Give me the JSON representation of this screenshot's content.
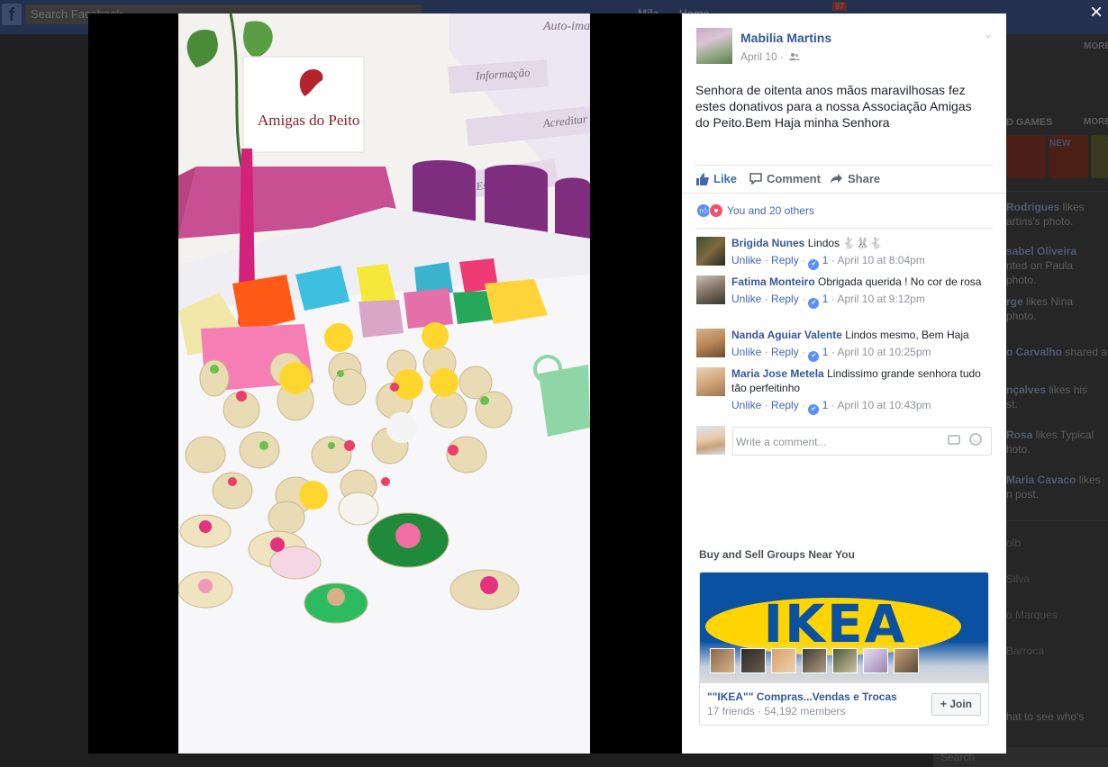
{
  "background": {
    "search_placeholder": "Search Facebook",
    "nav_name": "Mila",
    "nav_home": "Home",
    "notif_count": "97",
    "right_more": "MORE",
    "games_label": "D GAMES",
    "games_more": "MORE",
    "new_badge": "NEW",
    "ticker": [
      {
        "bold": "Rodrigues",
        "rest": " likes"
      },
      {
        "bold": "",
        "rest": "artins's photo."
      },
      {
        "bold": "sabel Oliveira",
        "rest": ""
      },
      {
        "bold": "",
        "rest": "nted on Paula"
      },
      {
        "bold": "",
        "rest": "photo."
      },
      {
        "bold": "rge",
        "rest": " likes Nina"
      },
      {
        "bold": "",
        "rest": "photo."
      },
      {
        "bold": "o Carvalho",
        "rest": " shared a"
      },
      {
        "bold": "nçalves",
        "rest": " likes his"
      },
      {
        "bold": "",
        "rest": "st."
      },
      {
        "bold": "Rosa",
        "rest": " likes Typical"
      },
      {
        "bold": "",
        "rest": "hoto."
      },
      {
        "bold": "Maria Cavaco",
        "rest": " likes"
      },
      {
        "bold": "",
        "rest": "n post."
      }
    ],
    "chat_names": [
      "olb",
      "Silva",
      "o Marques",
      "Barroca"
    ],
    "chat_footer": "hat to see who's",
    "bottom_search": "Search"
  },
  "viewer": {
    "close_label": "×"
  },
  "photo": {
    "sign_brand": "Amigas do Peito",
    "banner_words": [
      "Auto-ima",
      "Informação",
      "Acreditar",
      "Esperança"
    ]
  },
  "post": {
    "author": "Mabilia Martins",
    "date": "April 10 ·",
    "audience_icon": "friends-icon",
    "text": "Senhora de oitenta anos mãos maravilhosas fez estes donativos para a nossa Associação Amigas do Peito.Bem Haja minha Senhora",
    "actions": {
      "like": "Like",
      "comment": "Comment",
      "share": "Share"
    },
    "reactions_text": "You and 20 others"
  },
  "comments": [
    {
      "name": "Brigida Nunes",
      "text": "Lindos 🐇🐰🐇",
      "unlike": "Unlike",
      "reply": "Reply",
      "likes": "1",
      "time": "April 10 at 8:04pm"
    },
    {
      "name": "Fatima Monteiro",
      "text": "Obrigada querida ! No cor de rosa",
      "unlike": "Unlike",
      "reply": "Reply",
      "likes": "1",
      "time": "April 10 at 9:12pm"
    },
    {
      "name": "Nanda Aguiar Valente",
      "text": "Lindos mesmo, Bem Haja",
      "unlike": "Unlike",
      "reply": "Reply",
      "likes": "1",
      "time": "April 10 at 10:25pm"
    },
    {
      "name": "Maria Jose Metela",
      "text": "Lindissimo grande senhora tudo tão perfeitinho",
      "unlike": "Unlike",
      "reply": "Reply",
      "likes": "1",
      "time": "April 10 at 10:43pm"
    }
  ],
  "composer": {
    "placeholder": "Write a comment..."
  },
  "groups": {
    "title": "Buy and Sell Groups Near You",
    "card": {
      "image_word": "IKEA",
      "name": "\"\"IKEA\"\" Compras...Vendas e Trocas",
      "stats": "17 friends · 54,192 members",
      "join_label": "+ Join"
    }
  },
  "colors": {
    "brand_blue": "#4267b2",
    "link_blue": "#365899",
    "love_red": "#f25268",
    "ikea_blue": "#0a51a1",
    "ikea_yellow": "#ffd400"
  }
}
